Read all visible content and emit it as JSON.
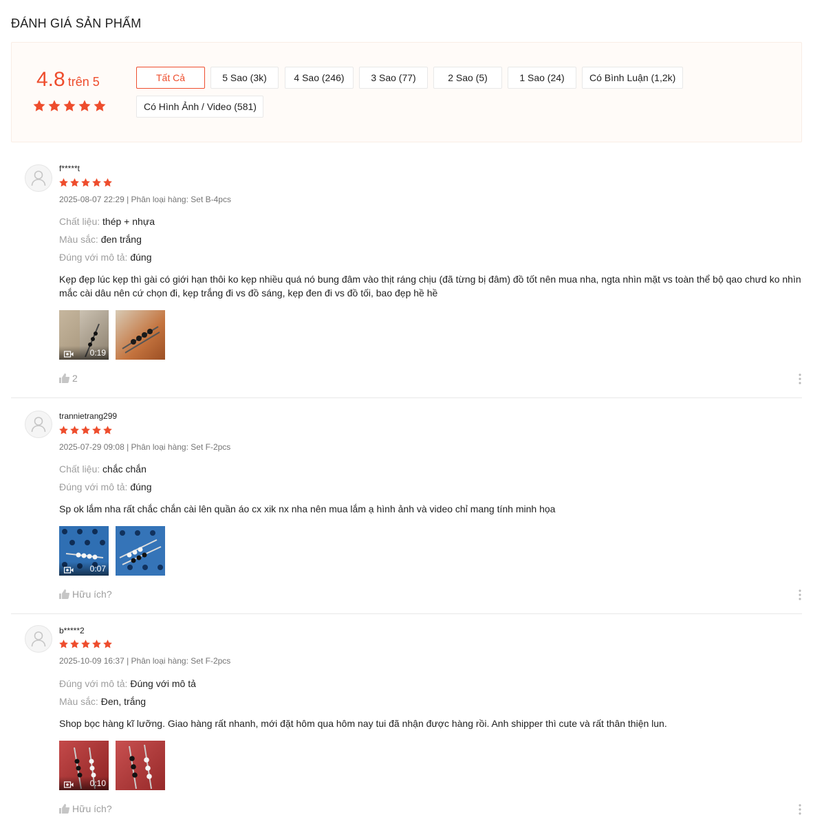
{
  "section_title": "ĐÁNH GIÁ SẢN PHẨM",
  "colors": {
    "accent": "#ee4d2d",
    "star": "#ee4d2d"
  },
  "overview": {
    "score": "4.8",
    "score_suffix": "trên 5",
    "stars": 5,
    "filters": [
      "Tất Cả",
      "5 Sao (3k)",
      "4 Sao (246)",
      "3 Sao (77)",
      "2 Sao (5)",
      "1 Sao (24)",
      "Có Bình Luận (1,2k)",
      "Có Hình Ảnh / Video (581)"
    ],
    "active_filter": "Tất Cả"
  },
  "reviews": [
    {
      "username": "f*****t",
      "rating": 5,
      "meta": "2025-08-07 22:29 | Phân loại hàng: Set B-4pcs",
      "attributes": [
        {
          "key": "Chất liệu:",
          "value": "thép + nhựa"
        },
        {
          "key": "Màu sắc:",
          "value": "đen trắng"
        },
        {
          "key": "Đúng với mô tả:",
          "value": "đúng"
        }
      ],
      "comment": "Kẹp đẹp lúc kẹp thì gài có giới hạn thôi ko kẹp nhiều quá nó bung đâm vào thịt ráng chịu (đã từng bị đâm) đồ tốt nên mua nha, ngta nhìn mặt vs toàn thể bộ qao chưd ko nhìn mắc cài dâu nên cứ chọn đi, kẹp trắng đi vs đồ sáng, kẹp đen đi vs đồ tối, bao đẹp hề hề",
      "media": [
        {
          "kind": "video",
          "duration": "0:19",
          "icon": "video-camera-icon"
        },
        {
          "kind": "image"
        }
      ],
      "like_label": "2"
    },
    {
      "username": "trannietrang299",
      "rating": 5,
      "meta": "2025-07-29 09:08 | Phân loại hàng: Set F-2pcs",
      "attributes": [
        {
          "key": "Chất liệu:",
          "value": "chắc chắn"
        },
        {
          "key": "Đúng với mô tả:",
          "value": "đúng"
        }
      ],
      "comment": "Sp ok lắm nha rất chắc chắn cài lên quần áo cx xik nx nha nên mua lắm ạ hình ảnh và video chỉ mang tính minh họa",
      "media": [
        {
          "kind": "video",
          "duration": "0:07",
          "icon": "video-camera-icon"
        },
        {
          "kind": "image"
        }
      ],
      "like_label": "Hữu ích?"
    },
    {
      "username": "b*****2",
      "rating": 5,
      "meta": "2025-10-09 16:37 | Phân loại hàng: Set F-2pcs",
      "attributes": [
        {
          "key": "Đúng với mô tả:",
          "value": "Đúng với mô tả"
        },
        {
          "key": "Màu sắc:",
          "value": "Đen, trắng"
        }
      ],
      "comment": "Shop bọc hàng kĩ lưỡng. Giao hàng rất nhanh, mới đặt hôm qua hôm nay tui đã nhận được hàng rồi. Anh shipper thì cute và rất thân thiện lun.",
      "media": [
        {
          "kind": "video",
          "duration": "0:10",
          "icon": "video-camera-icon"
        },
        {
          "kind": "image"
        }
      ],
      "like_label": "Hữu ích?"
    }
  ]
}
